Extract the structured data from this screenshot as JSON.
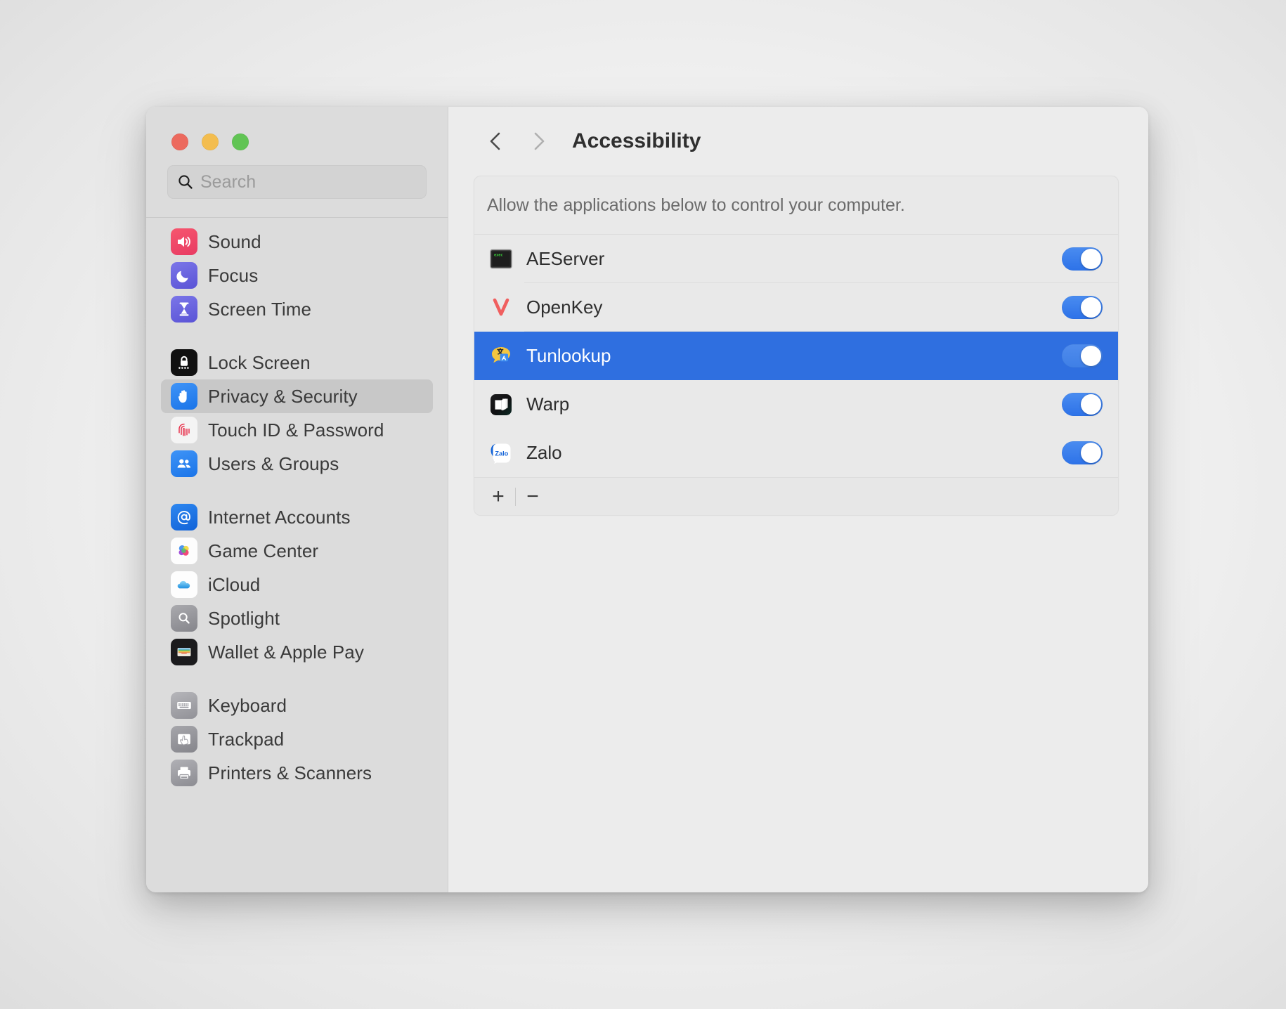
{
  "window": {
    "traffic_lights": [
      {
        "name": "close",
        "color": "#ec6a5e"
      },
      {
        "name": "minimize",
        "color": "#f3bd4f"
      },
      {
        "name": "zoom",
        "color": "#61c454"
      }
    ]
  },
  "sidebar": {
    "search": {
      "value": "",
      "placeholder": "Search"
    },
    "groups": [
      {
        "items": [
          {
            "label": "Sound",
            "icon": "sound-icon",
            "selected": false
          },
          {
            "label": "Focus",
            "icon": "focus-icon",
            "selected": false
          },
          {
            "label": "Screen Time",
            "icon": "screen-time-icon",
            "selected": false
          }
        ]
      },
      {
        "items": [
          {
            "label": "Lock Screen",
            "icon": "lock-icon",
            "selected": false
          },
          {
            "label": "Privacy & Security",
            "icon": "hand-icon",
            "selected": true
          },
          {
            "label": "Touch ID & Password",
            "icon": "fingerprint-icon",
            "selected": false
          },
          {
            "label": "Users & Groups",
            "icon": "users-icon",
            "selected": false
          }
        ]
      },
      {
        "items": [
          {
            "label": "Internet Accounts",
            "icon": "at-icon",
            "selected": false
          },
          {
            "label": "Game Center",
            "icon": "game-center-icon",
            "selected": false
          },
          {
            "label": "iCloud",
            "icon": "cloud-icon",
            "selected": false
          },
          {
            "label": "Spotlight",
            "icon": "magnifier-icon",
            "selected": false
          },
          {
            "label": "Wallet & Apple Pay",
            "icon": "wallet-icon",
            "selected": false
          }
        ]
      },
      {
        "items": [
          {
            "label": "Keyboard",
            "icon": "keyboard-icon",
            "selected": false
          },
          {
            "label": "Trackpad",
            "icon": "trackpad-icon",
            "selected": false
          },
          {
            "label": "Printers & Scanners",
            "icon": "printer-icon",
            "selected": false
          }
        ]
      }
    ]
  },
  "content": {
    "back_icon": "chevron-left-icon",
    "forward_icon": "chevron-right-icon",
    "title": "Accessibility",
    "panel_header": "Allow the applications below to control your computer.",
    "apps": [
      {
        "name": "AEServer",
        "icon": "aeserver-icon",
        "enabled": true,
        "selected": false,
        "toggle_state": "on"
      },
      {
        "name": "OpenKey",
        "icon": "openkey-icon",
        "enabled": true,
        "selected": false,
        "toggle_state": "on"
      },
      {
        "name": "Tunlookup",
        "icon": "tunlookup-icon",
        "enabled": true,
        "selected": true,
        "toggle_state": "on"
      },
      {
        "name": "Warp",
        "icon": "warp-icon",
        "enabled": true,
        "selected": false,
        "toggle_state": "on"
      },
      {
        "name": "Zalo",
        "icon": "zalo-icon",
        "enabled": true,
        "selected": false,
        "toggle_state": "on"
      }
    ],
    "footer": {
      "add_label": "+",
      "remove_label": "−"
    }
  },
  "colors": {
    "selection_blue": "#2f6fe0",
    "toggle_blue": "#2d72e8",
    "sidebar_bg": "#dcdcdc",
    "content_bg": "#ececec",
    "panel_bg": "#e9e9e9"
  }
}
